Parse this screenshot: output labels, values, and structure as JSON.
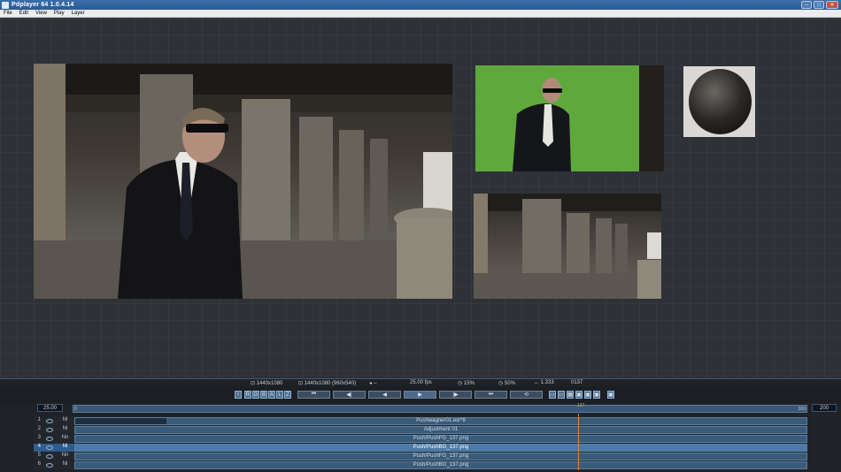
{
  "window": {
    "title": "Pdplayer 64 1.0.4.14",
    "buttons": [
      "–",
      "□",
      "✕"
    ]
  },
  "menu": [
    "File",
    "Edit",
    "View",
    "Play",
    "Layer"
  ],
  "info": {
    "res1": "⊡ 1440x1080",
    "res2": "⊡ 1440x1080 (960x540)",
    "arrows": "◂ --",
    "fps": "25.00 fps",
    "cache": "◷ 15%",
    "zoom": "◷ 50%",
    "aspect": "↔ 1.333",
    "frame": "0137"
  },
  "toolbar": {
    "channels": [
      "I",
      "R",
      "G",
      "B",
      "A",
      "L",
      "Z"
    ],
    "transport": [
      "⏮",
      "◀|",
      "◀",
      "▶",
      "|▶",
      "⏭",
      "⟲"
    ],
    "views": [
      "▭",
      "▭",
      "▦",
      "▣",
      "▣",
      "▣",
      "▣"
    ]
  },
  "timeline": {
    "fps": "25.00",
    "start": "0",
    "end": "200",
    "end_box": "200",
    "playhead": "137",
    "tracks": [
      {
        "num": "1",
        "blend": "Nl",
        "name": "Pushwagner01.exr*8"
      },
      {
        "num": "2",
        "blend": "Nl",
        "name": "Adjustment 01"
      },
      {
        "num": "3",
        "blend": "Nn",
        "name": "Push/PushFG_137.png"
      },
      {
        "num": "4",
        "blend": "Nl",
        "name": "Push/PushBG_137.png"
      },
      {
        "num": "5",
        "blend": "Nn",
        "name": "Push/PushFG_137.png"
      },
      {
        "num": "6",
        "blend": "Nl",
        "name": "Push/PushBG_137.png"
      }
    ]
  }
}
